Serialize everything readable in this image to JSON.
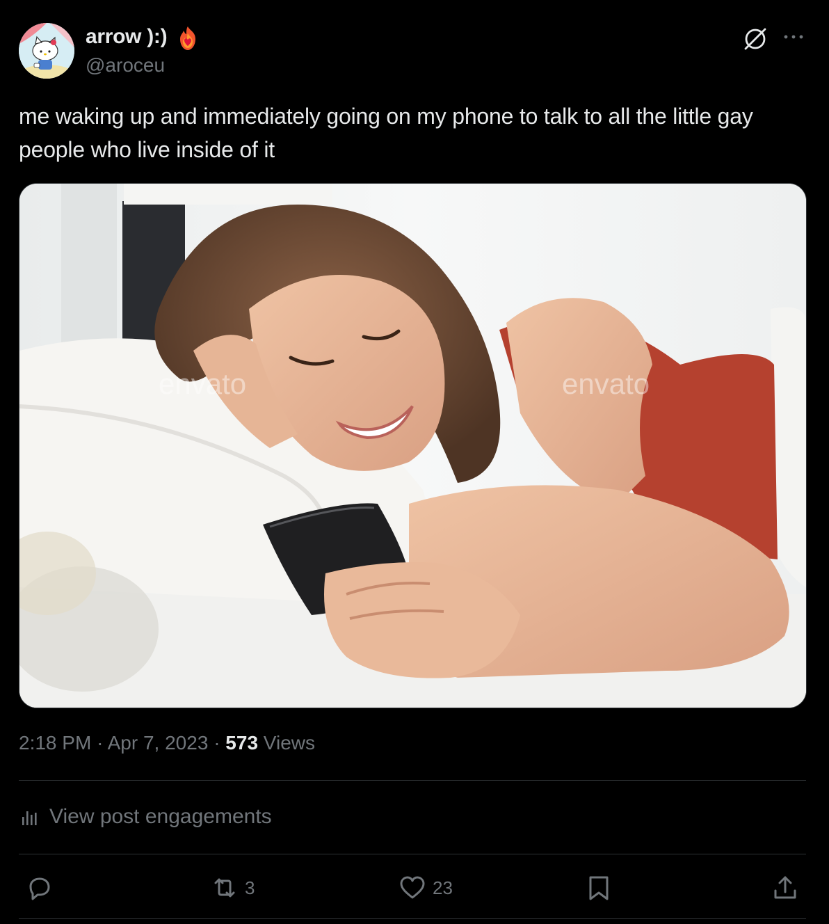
{
  "author": {
    "display_name": "arrow ):)",
    "handle": "@aroceu"
  },
  "post": {
    "text": "me waking up and immediately going on my phone to talk to all the little gay people who live inside of it",
    "media_watermark": "envato"
  },
  "meta": {
    "time": "2:18 PM",
    "separator": "·",
    "date": "Apr 7, 2023",
    "views_count": "573",
    "views_label": "Views"
  },
  "engagements": {
    "label": "View post engagements"
  },
  "actions": {
    "reply_count": "",
    "repost_count": "3",
    "like_count": "23"
  },
  "icons": {
    "avatar": "hello-kitty-avatar",
    "badge": "fire-heart-icon",
    "grok": "grok-icon",
    "more": "more-icon",
    "engagements": "bar-chart-icon",
    "reply": "reply-icon",
    "repost": "repost-icon",
    "like": "heart-icon",
    "bookmark": "bookmark-icon",
    "share": "share-icon"
  },
  "colors": {
    "background": "#000000",
    "primary_text": "#e7e9ea",
    "secondary_text": "#71767b",
    "divider": "#2f3336"
  }
}
